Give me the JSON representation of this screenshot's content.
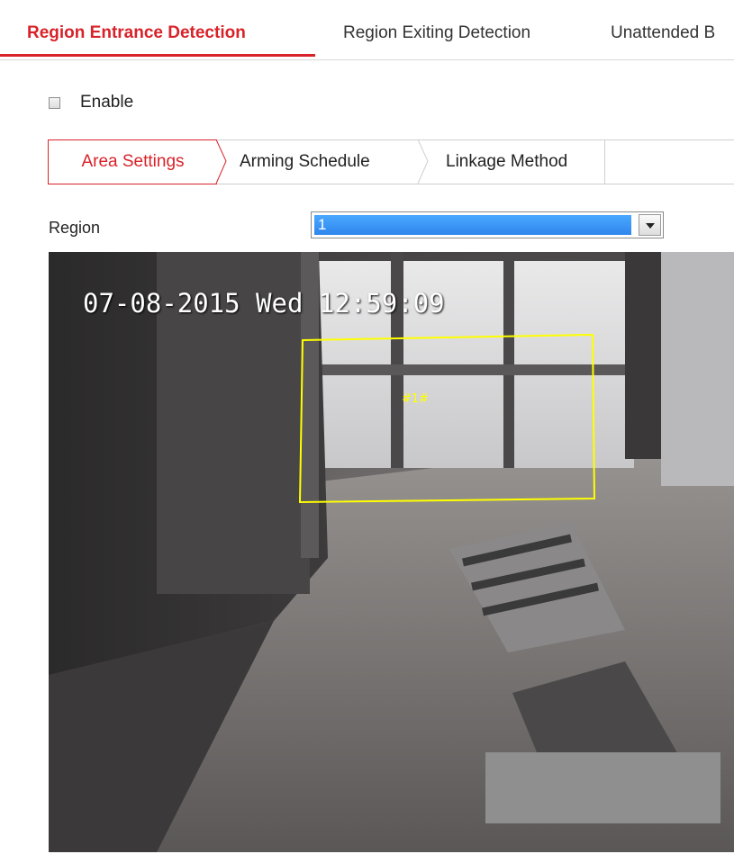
{
  "top_tabs": [
    {
      "label": "Region Entrance Detection",
      "active": true
    },
    {
      "label": "Region Exiting Detection",
      "active": false
    },
    {
      "label": "Unattended B",
      "active": false
    }
  ],
  "enable": {
    "label": "Enable",
    "checked": false
  },
  "sub_tabs": [
    {
      "label": "Area Settings",
      "active": true
    },
    {
      "label": "Arming Schedule",
      "active": false
    },
    {
      "label": "Linkage Method",
      "active": false
    }
  ],
  "region": {
    "label": "Region",
    "value": "1"
  },
  "video": {
    "osd_text": "07-08-2015 Wed 12:59:09",
    "region_label": "#1#"
  },
  "colors": {
    "accent": "#d8232a",
    "region_outline": "#ffff00",
    "select_highlight": "#3a95f5"
  }
}
